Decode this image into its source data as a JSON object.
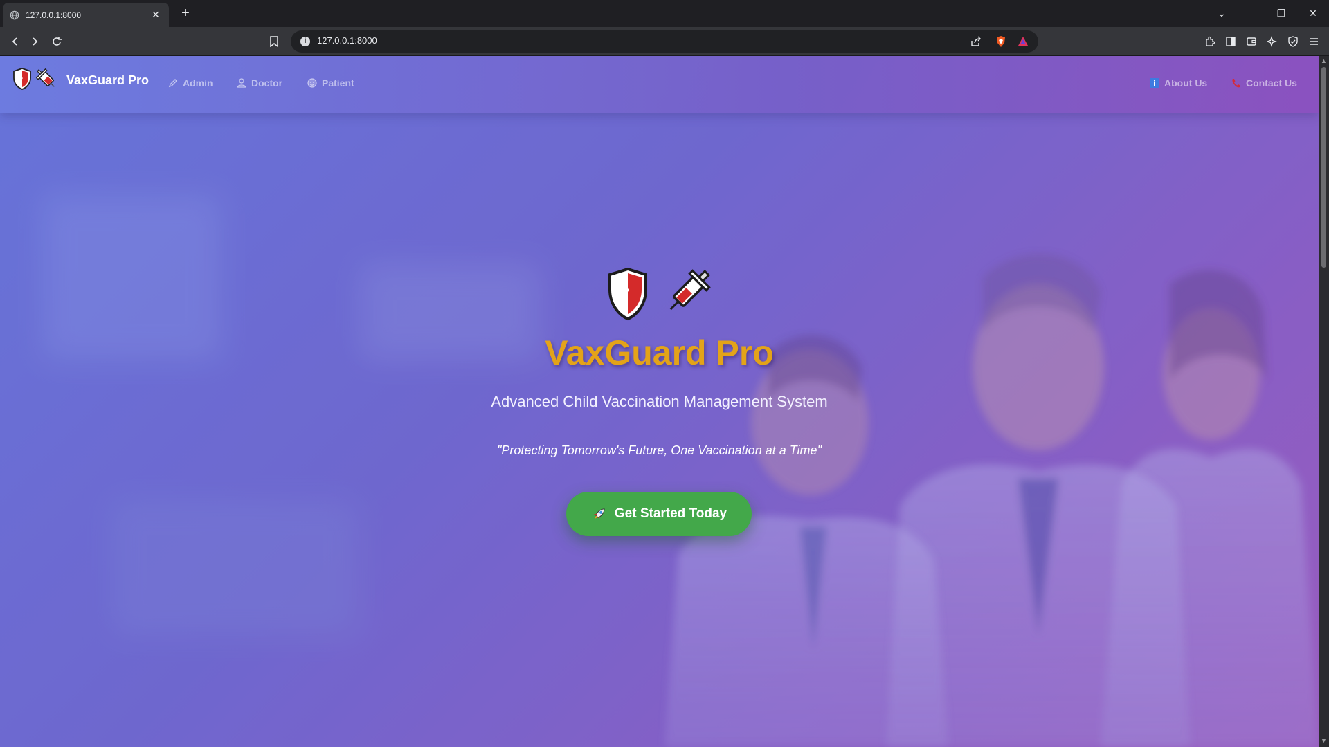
{
  "browser": {
    "tab_title": "127.0.0.1:8000",
    "url": "127.0.0.1:8000"
  },
  "page": {
    "brand": "VaxGuard Pro",
    "nav": {
      "admin": "Admin",
      "doctor": "Doctor",
      "patient": "Patient",
      "about": "About Us",
      "contact": "Contact Us"
    },
    "hero": {
      "title": "VaxGuard Pro",
      "subtitle": "Advanced Child Vaccination Management System",
      "tagline": "\"Protecting Tomorrow's Future, One Vaccination at a Time\"",
      "cta": "Get Started Today"
    }
  },
  "colors": {
    "hero_title": "#e3a319",
    "cta": "#43a84a",
    "gradient_start": "#6477db",
    "gradient_end": "#9e5cbd"
  },
  "icons": {
    "brand": [
      "shield-icon",
      "syringe-icon"
    ],
    "admin": "pencil-icon",
    "doctor": "user-icon",
    "patient": "patient-icon",
    "about": "info-icon",
    "contact": "phone-icon",
    "cta": "rocket-icon"
  }
}
